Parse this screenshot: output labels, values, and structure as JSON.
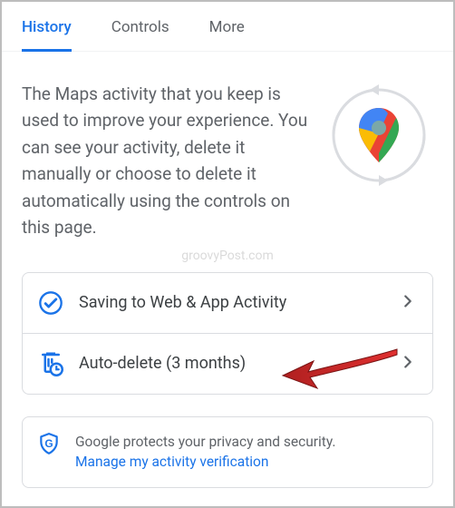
{
  "tabs": {
    "t0": "History",
    "t1": "Controls",
    "t2": "More"
  },
  "description": "The Maps activity that you keep is used to improve your experience. You can see your activity, delete it manually or choose to delete it automatically using the controls on this page.",
  "watermark": "groovyPost.com",
  "rows": {
    "saving": "Saving to Web & App Activity",
    "autodelete": "Auto-delete (3 months)"
  },
  "info": {
    "text": "Google protects your privacy and security.",
    "link": "Manage my activity verification"
  },
  "colors": {
    "accent": "#1a73e8"
  }
}
